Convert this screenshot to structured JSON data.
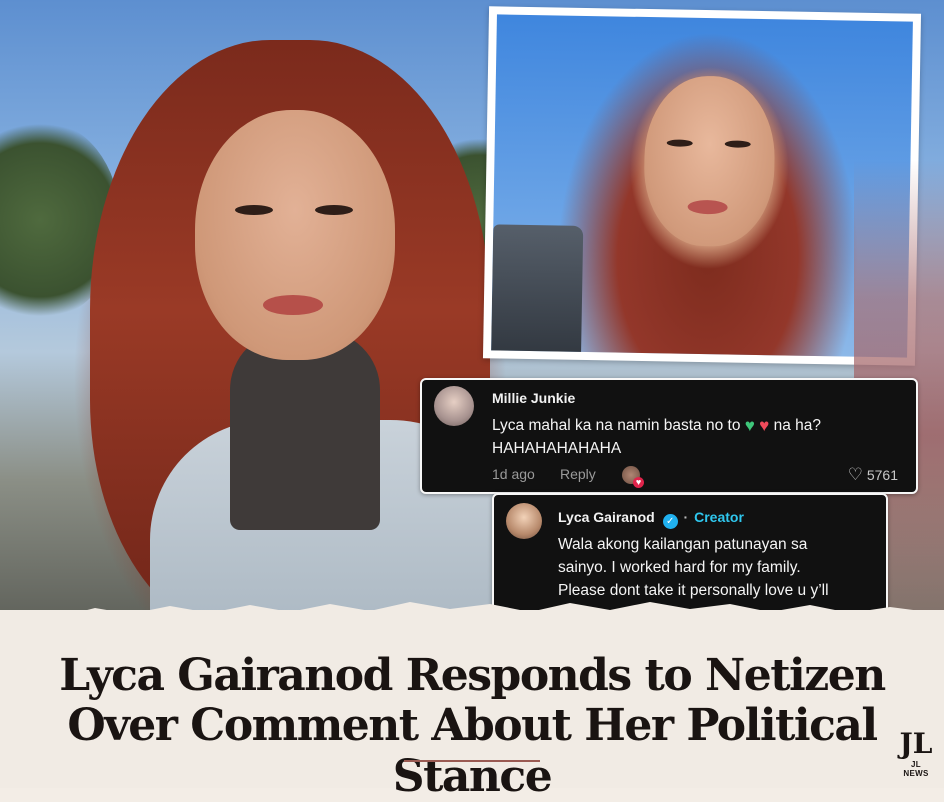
{
  "comment": {
    "author": "Millie Junkie",
    "text_line1": "Lyca mahal ka na namin basta no to",
    "text_after_hearts": "na ha?",
    "text_line2": "HAHAHAHAHAHA",
    "time": "1d ago",
    "reply_label": "Reply",
    "likes": "5761",
    "heart_colors": [
      "#3ec67a",
      "#f04a5a"
    ]
  },
  "reply": {
    "author": "Lyca Gairanod",
    "separator": "·",
    "badge_label": "Creator",
    "text_lines": [
      "Wala akong kailangan patunayan sa",
      "sainyo.  I worked hard for my family.",
      "Please dont take it personally love u y’ll"
    ],
    "heart_color": "#8e67c9"
  },
  "headline": {
    "line1": "Lyca Gairanod Responds to Netizen",
    "line2": "Over Comment About Her Political Stance"
  },
  "logo": {
    "mark": "JL",
    "text": "JL NEWS"
  },
  "colors": {
    "accent_brush": "#a9696c",
    "creator_blue": "#2fc7ee",
    "verified_blue": "#20b1f0"
  }
}
